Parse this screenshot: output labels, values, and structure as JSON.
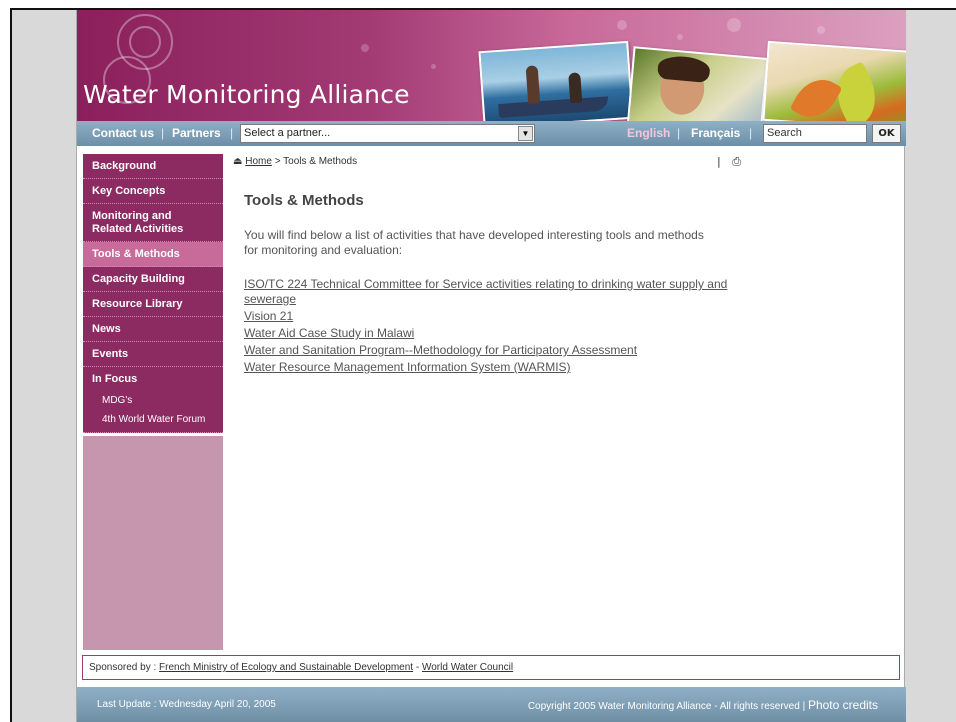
{
  "header": {
    "site_title": "Water Monitoring Alliance"
  },
  "navbar": {
    "contact_label": "Contact us",
    "partners_label": "Partners",
    "separator": "|",
    "partner_select_value": "Select a partner...",
    "lang_english": "English",
    "lang_french": "Français",
    "search_placeholder": "Search",
    "ok_label": "OK"
  },
  "sidebar": {
    "items": [
      {
        "label": "Background"
      },
      {
        "label": "Key Concepts"
      },
      {
        "label": "Monitoring and Related Activities"
      },
      {
        "label": "Tools & Methods"
      },
      {
        "label": "Capacity Building"
      },
      {
        "label": "Resource Library"
      },
      {
        "label": "News"
      },
      {
        "label": "Events"
      },
      {
        "label": "In Focus"
      }
    ],
    "in_focus_sub": [
      "MDG's",
      "4th World Water Forum"
    ]
  },
  "breadcrumb": {
    "home": "Home",
    "current": "> Tools & Methods"
  },
  "print_area": {
    "separator": "|",
    "print_icon": "printer-icon"
  },
  "main": {
    "title": "Tools & Methods",
    "intro": "You will find below a list of activities that have developed interesting tools and methods for monitoring and evaluation:",
    "links": [
      "ISO/TC 224 Technical Committee for Service activities relating to drinking water supply and sewerage",
      "Vision 21",
      "Water Aid Case Study in Malawi",
      "Water and Sanitation Program--Methodology for Participatory Assessment",
      "Water Resource Management Information System (WARMIS)"
    ]
  },
  "sponsor": {
    "prefix": "Sponsored by :",
    "sponsor_1": "French Ministry of Ecology and Sustainable Development",
    "dash": "-",
    "sponsor_2": "World Water Council"
  },
  "footer": {
    "last_update": "Last Update : Wednesday April 20, 2005",
    "copyright": "Copyright 2005 Water Monitoring Alliance - All rights reserved |",
    "photo_credits": "Photo credits"
  },
  "colors": {
    "brand_magenta": "#8c2a62",
    "active_pink": "#c86a9a",
    "nav_blue": "#7d9fb8"
  }
}
